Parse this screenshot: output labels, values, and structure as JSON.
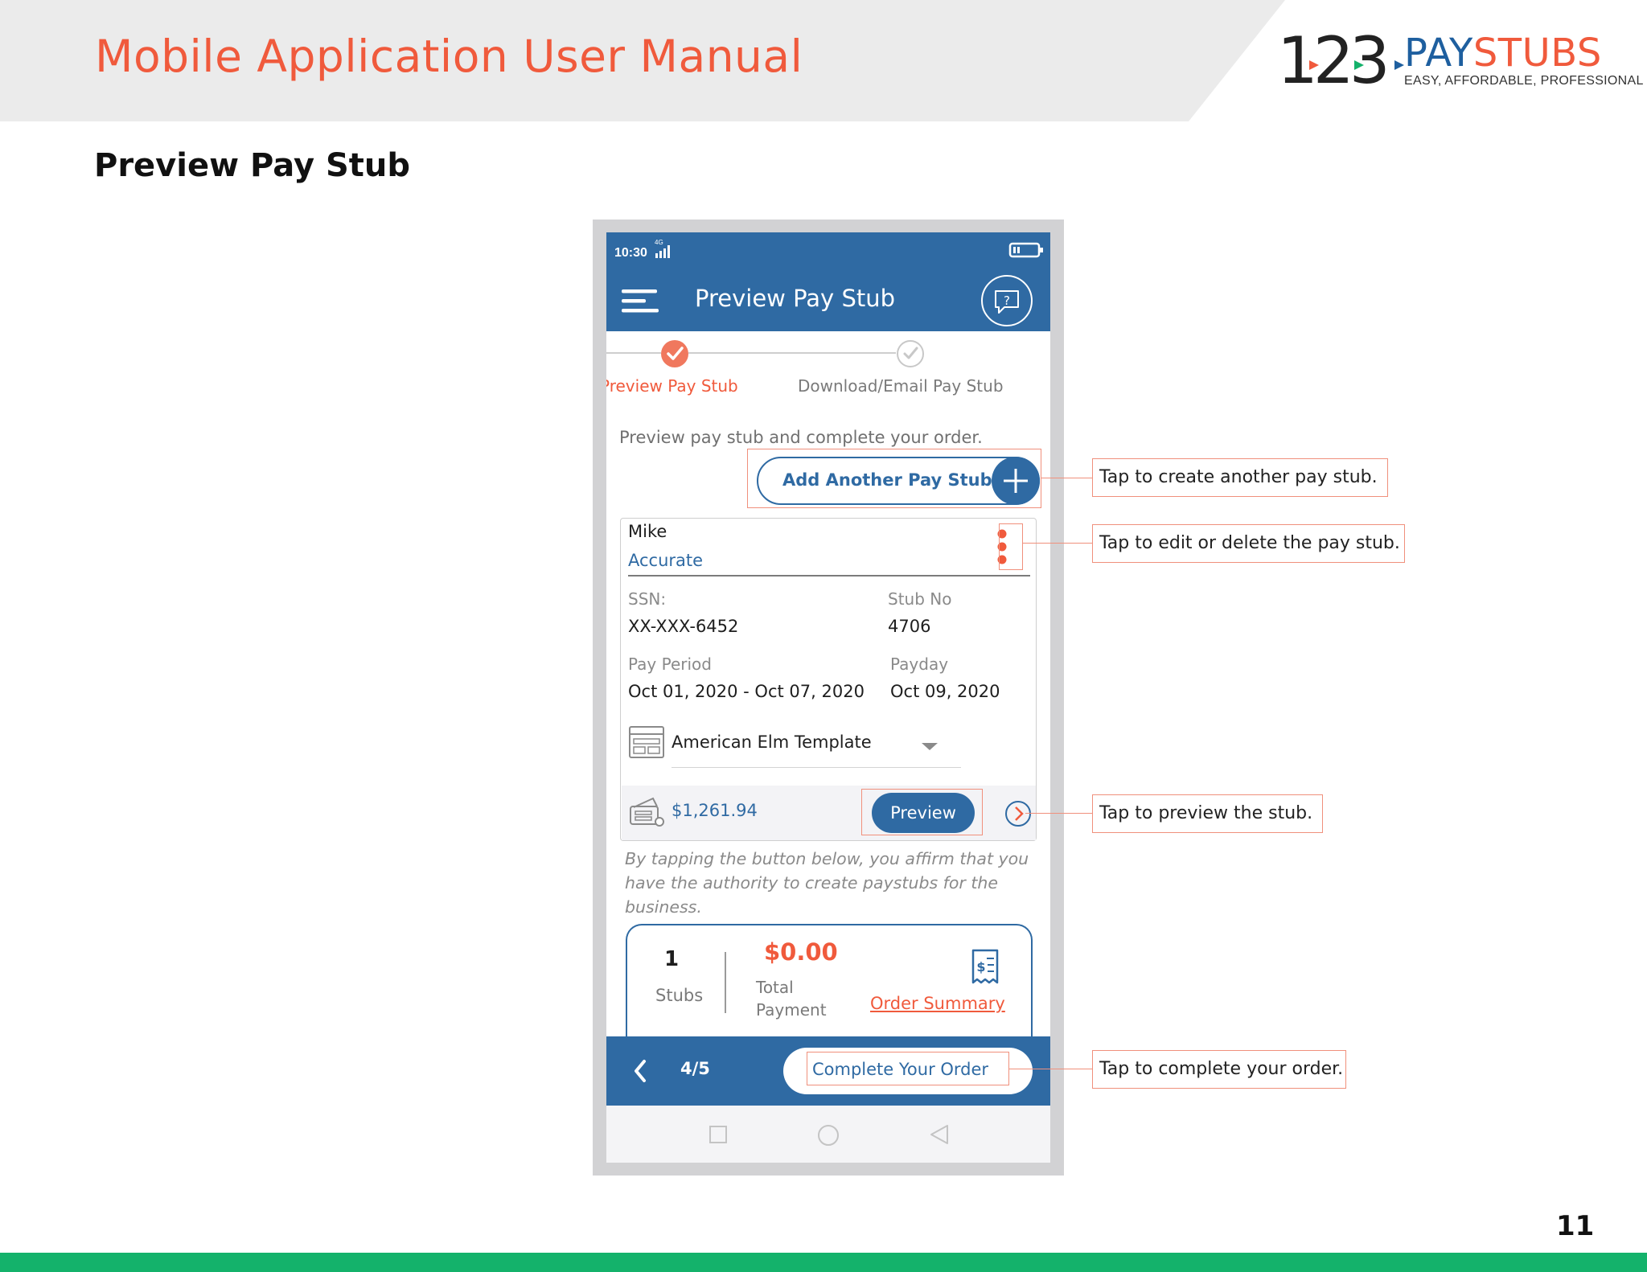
{
  "colors": {
    "accent": "#f05a3c",
    "brand_blue": "#2f6aa3",
    "footer_green": "#14b26b",
    "header_band": "#ebebeb"
  },
  "manual": {
    "title": "Mobile Application User Manual",
    "section_title": "Preview Pay Stub",
    "page_number": "11"
  },
  "logo": {
    "number": "123",
    "word_1": "PAY",
    "word_2": "STUBS",
    "tagline": "EASY, AFFORDABLE, PROFESSIONAL"
  },
  "app": {
    "status_time": "10:30",
    "network": "4G",
    "title": "Preview Pay Stub",
    "steps": [
      {
        "label": "Preview Pay Stub",
        "state": "active"
      },
      {
        "label": "Download/Email Pay Stub",
        "state": "pending"
      }
    ],
    "intro": "Preview pay stub and complete your order.",
    "add_button": "Add Another Pay Stub",
    "stub": {
      "first_name": "Mike",
      "last_name": "Accurate",
      "ssn_label": "SSN:",
      "ssn_value": "XX-XXX-6452",
      "stub_no_label": "Stub No",
      "stub_no_value": "4706",
      "pay_period_label": "Pay Period",
      "pay_period_value": "Oct 01, 2020 - Oct 07, 2020",
      "payday_label": "Payday",
      "payday_value": "Oct 09, 2020",
      "template": "American Elm Template",
      "amount": "$1,261.94",
      "preview_button": "Preview"
    },
    "disclaimer": "By tapping the button below, you affirm that you have the authority to create paystubs for the business.",
    "summary": {
      "count": "1",
      "count_label": "Stubs",
      "total": "$0.00",
      "total_label_1": "Total",
      "total_label_2": "Payment",
      "order_summary": "Order Summary"
    },
    "pager": "4/5",
    "complete_button": "Complete Your Order"
  },
  "callouts": {
    "add": "Tap to create another pay stub.",
    "edit": "Tap to edit or delete the pay stub.",
    "preview": "Tap to preview the stub.",
    "complete": "Tap to complete your order."
  }
}
